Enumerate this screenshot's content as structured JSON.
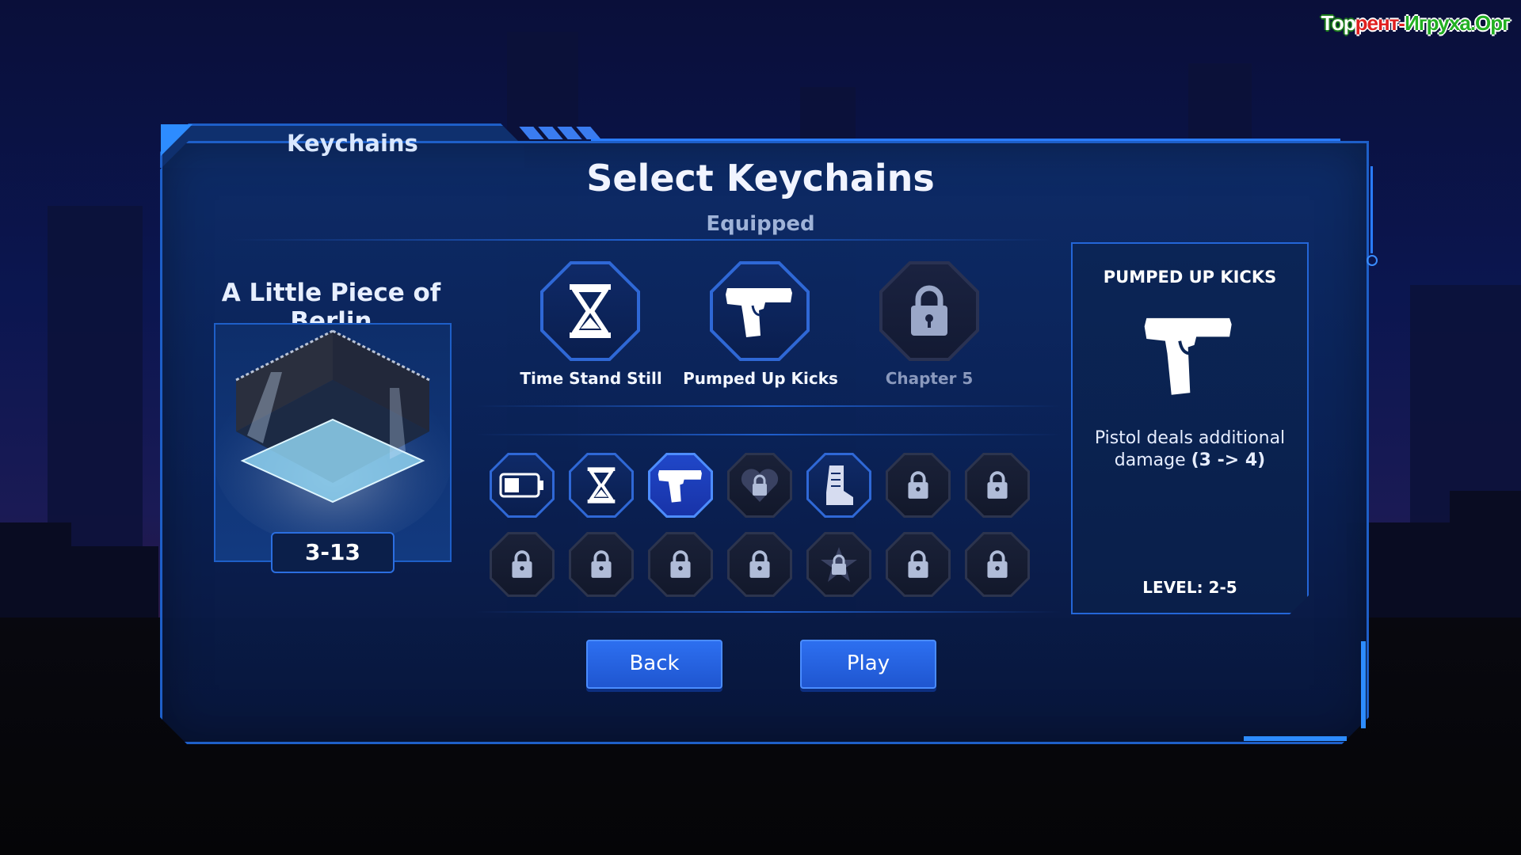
{
  "watermark": {
    "part1": "Тор",
    "part2": "рент-",
    "part3": "Игруха.Орг"
  },
  "tab": {
    "title": "Keychains"
  },
  "header": {
    "title": "Select Keychains",
    "subtitle": "Equipped"
  },
  "level": {
    "name": "A Little Piece of Berlin",
    "code": "3-13"
  },
  "equipped": [
    {
      "label": "Time Stand Still",
      "icon": "hourglass-icon",
      "locked": false
    },
    {
      "label": "Pumped Up Kicks",
      "icon": "pistol-icon",
      "locked": false
    },
    {
      "label": "Chapter 5",
      "icon": "lock-icon",
      "locked": true
    }
  ],
  "inventory": [
    {
      "icon": "battery-icon",
      "state": "owned"
    },
    {
      "icon": "hourglass-icon",
      "state": "owned"
    },
    {
      "icon": "pistol-icon",
      "state": "selected"
    },
    {
      "icon": "heart-lock-icon",
      "state": "locked"
    },
    {
      "icon": "boot-icon",
      "state": "owned"
    },
    {
      "icon": "lock-icon",
      "state": "locked"
    },
    {
      "icon": "lock-icon",
      "state": "locked"
    },
    {
      "icon": "lock-icon",
      "state": "locked"
    },
    {
      "icon": "lock-icon",
      "state": "locked"
    },
    {
      "icon": "lock-icon",
      "state": "locked"
    },
    {
      "icon": "lock-icon",
      "state": "locked"
    },
    {
      "icon": "star-lock-icon",
      "state": "locked"
    },
    {
      "icon": "lock-icon",
      "state": "locked"
    },
    {
      "icon": "lock-icon",
      "state": "locked"
    }
  ],
  "detail": {
    "title": "PUMPED UP KICKS",
    "desc_prefix": "Pistol deals additional damage ",
    "desc_bold": "(3 -> 4)",
    "level": "LEVEL: 2-5"
  },
  "buttons": {
    "back": "Back",
    "play": "Play"
  },
  "colors": {
    "accent": "#2d8cff",
    "panel": "#0e2c68",
    "button": "#2d6ff0"
  }
}
